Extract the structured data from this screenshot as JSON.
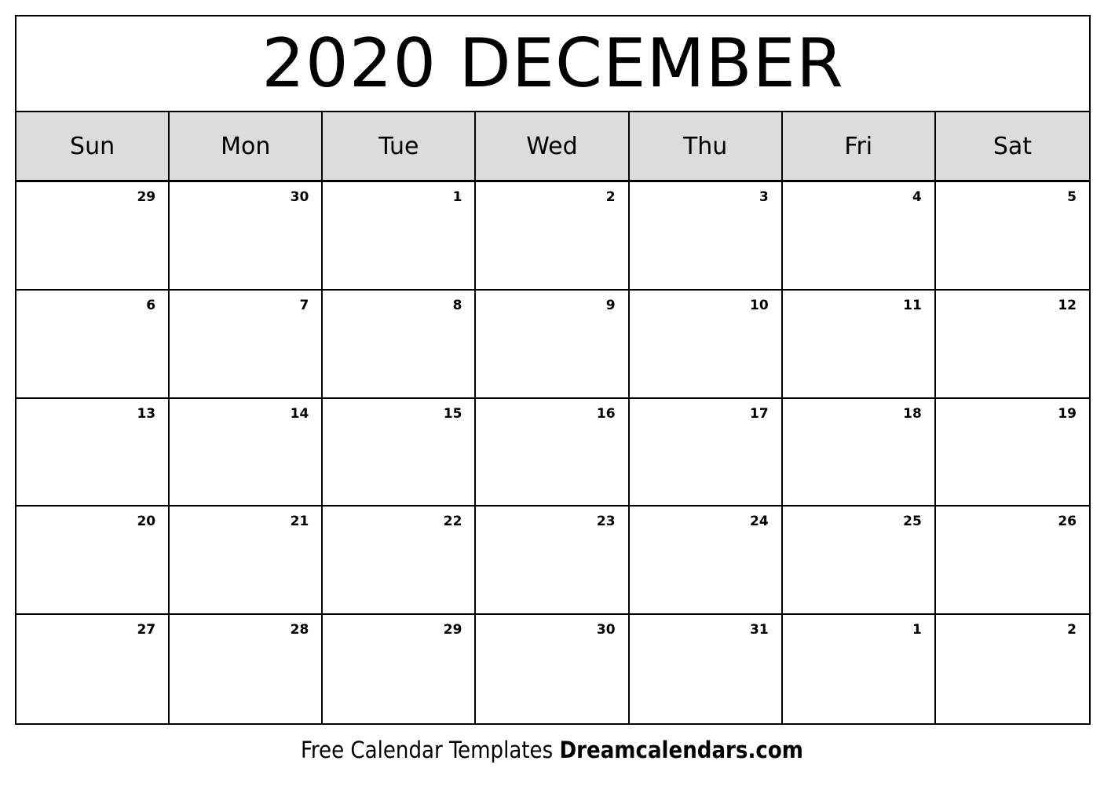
{
  "title": "2020 DECEMBER",
  "weekdays": [
    "Sun",
    "Mon",
    "Tue",
    "Wed",
    "Thu",
    "Fri",
    "Sat"
  ],
  "weeks": [
    [
      {
        "day": "29",
        "in_month": false
      },
      {
        "day": "30",
        "in_month": false
      },
      {
        "day": "1",
        "in_month": true
      },
      {
        "day": "2",
        "in_month": true
      },
      {
        "day": "3",
        "in_month": true
      },
      {
        "day": "4",
        "in_month": true
      },
      {
        "day": "5",
        "in_month": true
      }
    ],
    [
      {
        "day": "6",
        "in_month": true
      },
      {
        "day": "7",
        "in_month": true
      },
      {
        "day": "8",
        "in_month": true
      },
      {
        "day": "9",
        "in_month": true
      },
      {
        "day": "10",
        "in_month": true
      },
      {
        "day": "11",
        "in_month": true
      },
      {
        "day": "12",
        "in_month": true
      }
    ],
    [
      {
        "day": "13",
        "in_month": true
      },
      {
        "day": "14",
        "in_month": true
      },
      {
        "day": "15",
        "in_month": true
      },
      {
        "day": "16",
        "in_month": true
      },
      {
        "day": "17",
        "in_month": true
      },
      {
        "day": "18",
        "in_month": true
      },
      {
        "day": "19",
        "in_month": true
      }
    ],
    [
      {
        "day": "20",
        "in_month": true
      },
      {
        "day": "21",
        "in_month": true
      },
      {
        "day": "22",
        "in_month": true
      },
      {
        "day": "23",
        "in_month": true
      },
      {
        "day": "24",
        "in_month": true
      },
      {
        "day": "25",
        "in_month": true
      },
      {
        "day": "26",
        "in_month": true
      }
    ],
    [
      {
        "day": "27",
        "in_month": true
      },
      {
        "day": "28",
        "in_month": true
      },
      {
        "day": "29",
        "in_month": true
      },
      {
        "day": "30",
        "in_month": true
      },
      {
        "day": "31",
        "in_month": true
      },
      {
        "day": "1",
        "in_month": false
      },
      {
        "day": "2",
        "in_month": false
      }
    ]
  ],
  "footer": {
    "text": "Free Calendar Templates ",
    "brand": "Dreamcalendars.com"
  },
  "colors": {
    "header_bg": "#dcdcdc",
    "border": "#000000"
  }
}
